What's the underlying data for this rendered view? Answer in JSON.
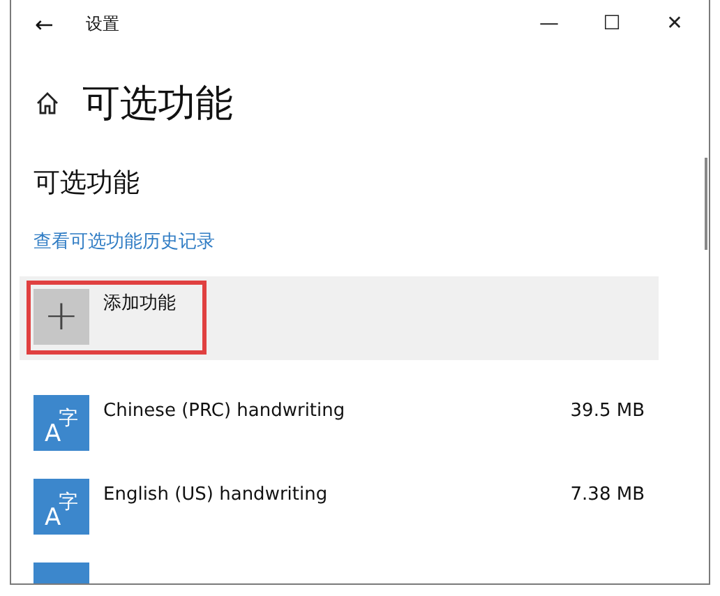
{
  "window": {
    "title": "设置",
    "back": "←",
    "controls": [
      "—",
      "☐",
      "✕"
    ]
  },
  "page": {
    "title": "可选功能"
  },
  "section": {
    "heading": "可选功能",
    "history_link": "查看可选功能历史记录"
  },
  "add_feature": {
    "label": "添加功能",
    "icon": "+",
    "highlighted": true
  },
  "features": [
    {
      "kind": "language",
      "name": "Chinese (PRC) handwriting",
      "size": "39.5 MB",
      "icon": {
        "letter": "A",
        "char": "字"
      }
    },
    {
      "kind": "language",
      "name": "English (US) handwriting",
      "size": "7.38 MB",
      "icon": {
        "letter": "A",
        "char": "字"
      }
    },
    {
      "kind": "language"
    }
  ]
}
